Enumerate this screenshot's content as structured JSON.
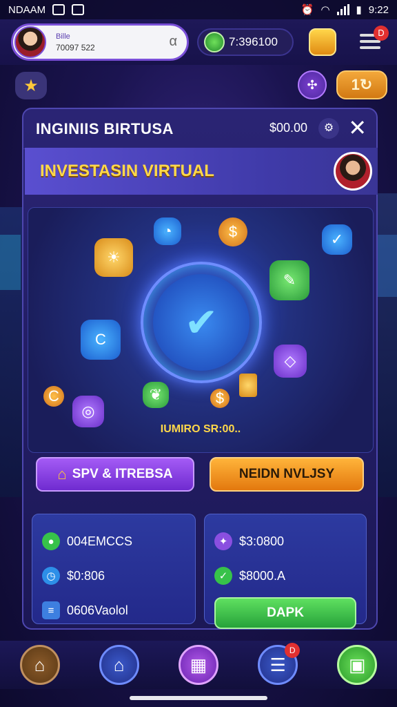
{
  "status_bar": {
    "carrier": "NDAAM",
    "time": "9:22",
    "notification_badge": "D"
  },
  "header": {
    "profile_name": "Bille",
    "profile_id": "70097 522",
    "profile_close": "α",
    "coin_balance": "7:396100",
    "menu_badge": "D"
  },
  "subheader": {
    "refresh_label": "1"
  },
  "panel": {
    "title": "INGINIIS BIRTUSA",
    "balance": "$00.00",
    "close": "✕"
  },
  "banner": {
    "title": "INVESTASIN VIRTUAL"
  },
  "scene": {
    "caption": "IUMIRO SR:00.."
  },
  "actions": {
    "primary_label": "SPV & ITREBSA",
    "secondary_label": "NEIDN NVLJSY"
  },
  "stats_left": {
    "items": [
      {
        "icon": "coin-icon",
        "label": "004EMCCS"
      },
      {
        "icon": "clock-icon",
        "label": "$0:806"
      },
      {
        "icon": "document-icon",
        "label": "0606Vaolol"
      }
    ]
  },
  "stats_right": {
    "items": [
      {
        "icon": "star-icon",
        "label": "$3:0800"
      },
      {
        "icon": "check-icon",
        "label": "$8000.A"
      }
    ],
    "button_label": "DAPK"
  },
  "bottom_nav": {
    "list_badge": "D"
  },
  "colors": {
    "accent_purple": "#7a4fd8",
    "accent_orange": "#f3a83b",
    "accent_green": "#26a23a",
    "title_yellow": "#ffd84a"
  }
}
